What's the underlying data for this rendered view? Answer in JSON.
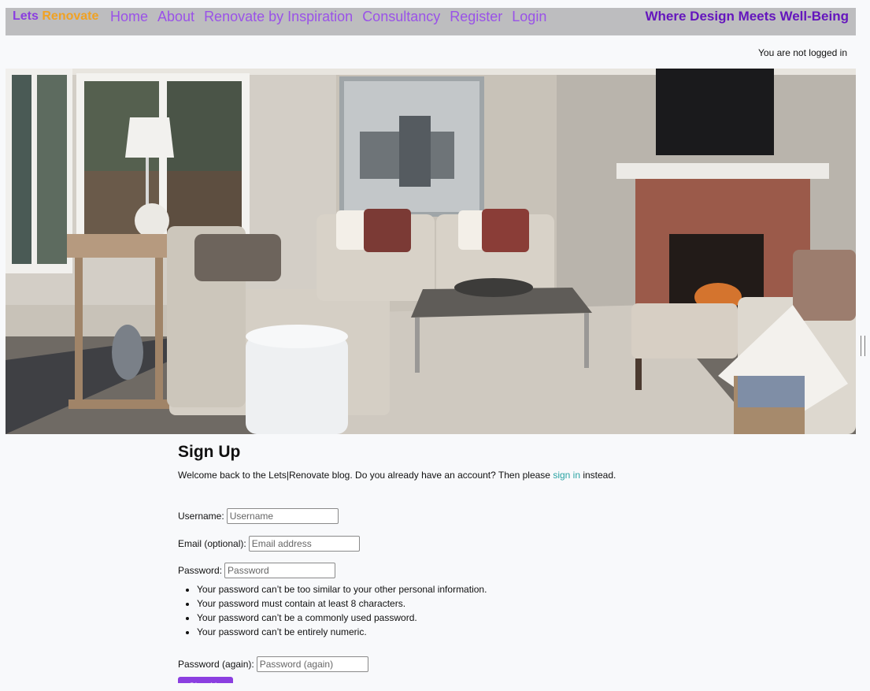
{
  "brand": {
    "part1": "Lets",
    "part2": "Renovate"
  },
  "nav": {
    "home": "Home",
    "about": "About",
    "inspiration": "Renovate by Inspiration",
    "consultancy": "Consultancy",
    "register": "Register",
    "login": "Login"
  },
  "tagline": "Where Design Meets Well-Being",
  "login_status": "You are not logged in",
  "form": {
    "title": "Sign Up",
    "intro_before": "Welcome back to the Lets|Renovate blog. Do you already have an account? Then please ",
    "intro_link": "sign in",
    "intro_after": " instead.",
    "username_label": "Username:",
    "username_placeholder": "Username",
    "email_label": "Email (optional):",
    "email_placeholder": "Email address",
    "password_label": "Password:",
    "password_placeholder": "Password",
    "password_rules": [
      "Your password can’t be too similar to your other personal information.",
      "Your password must contain at least 8 characters.",
      "Your password can’t be a commonly used password.",
      "Your password can’t be entirely numeric."
    ],
    "password2_label": "Password (again):",
    "password2_placeholder": "Password (again)",
    "submit_label": "Sign Up"
  },
  "colors": {
    "navbar_bg": "#bdbdbf",
    "nav_link": "#9a52e8",
    "brand_purple": "#8b3fe0",
    "brand_orange": "#f0a223",
    "tagline": "#6516bd",
    "link_teal": "#2aa3a3",
    "button": "#8b3fe0"
  }
}
